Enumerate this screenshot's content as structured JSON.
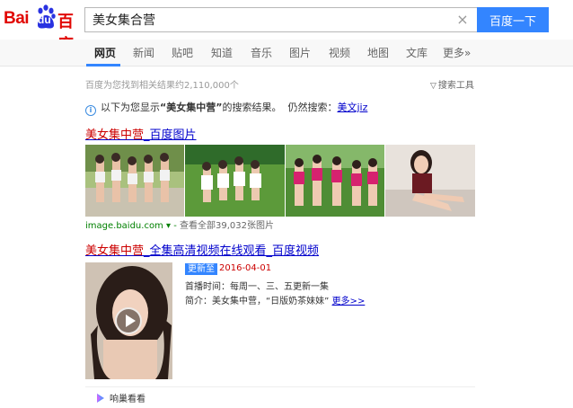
{
  "logo": {
    "text_latin_left": "Bai",
    "text_du": "du",
    "text_cn": "百度",
    "color": "#e10602"
  },
  "search": {
    "query": "美女集合营",
    "button_label": "百度一下",
    "clear_icon": "close-icon"
  },
  "tabs": [
    {
      "label": "网页",
      "active": true
    },
    {
      "label": "新闻"
    },
    {
      "label": "贴吧"
    },
    {
      "label": "知道"
    },
    {
      "label": "音乐"
    },
    {
      "label": "图片"
    },
    {
      "label": "视频"
    },
    {
      "label": "地图"
    },
    {
      "label": "文库"
    },
    {
      "label": "更多»"
    }
  ],
  "result_count": "百度为您找到相关结果约2,110,000个",
  "search_tools": "搜索工具",
  "notice": {
    "prefix": "以下为您显示",
    "query": "“美女集中营”",
    "suffix": "的搜索结果。",
    "still_search": "仍然搜索：",
    "alt_query": "美文jiz"
  },
  "result1": {
    "title_em": "美女集中营",
    "title_rest": "_百度图片",
    "source_url": "image.baidu.com",
    "more_images": "查看全部39,032张图片"
  },
  "result2": {
    "title_em": "美女集中营",
    "title_rest": "_全集高清视频在线观看_百度视频",
    "badge": "更新至",
    "date": "2016-04-01",
    "air_time_label": "首播时间：",
    "air_time_value": "每周一、三、五更新一集",
    "intro_label": "简介：",
    "intro_value": "美女集中营，“日版奶茶妹妹”",
    "more_link": "更多>>"
  },
  "footer": {
    "label": "响巢看看"
  },
  "colors": {
    "accent_blue": "#3385ff",
    "link_blue": "#00c",
    "highlight_red": "#c00",
    "url_green": "#008000"
  }
}
